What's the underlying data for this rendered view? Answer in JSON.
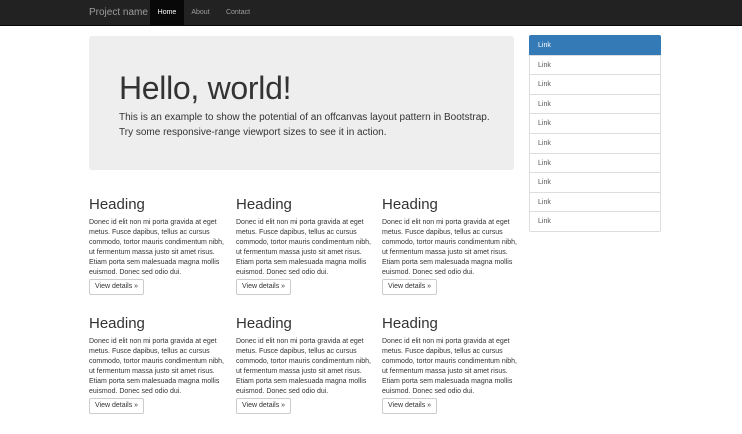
{
  "navbar": {
    "brand": "Project name",
    "items": [
      {
        "label": "Home",
        "active": true
      },
      {
        "label": "About",
        "active": false
      },
      {
        "label": "Contact",
        "active": false
      }
    ]
  },
  "jumbotron": {
    "title": "Hello, world!",
    "text": "This is an example to show the potential of an offcanvas layout pattern in Bootstrap. Try some responsive-range viewport sizes to see it in action."
  },
  "columns": [
    {
      "heading": "Heading",
      "body": "Donec id elit non mi porta gravida at eget metus. Fusce dapibus, tellus ac cursus commodo, tortor mauris condimentum nibh, ut fermentum massa justo sit amet risus. Etiam porta sem malesuada magna mollis euismod. Donec sed odio dui.",
      "button": "View details »"
    },
    {
      "heading": "Heading",
      "body": "Donec id elit non mi porta gravida at eget metus. Fusce dapibus, tellus ac cursus commodo, tortor mauris condimentum nibh, ut fermentum massa justo sit amet risus. Etiam porta sem malesuada magna mollis euismod. Donec sed odio dui.",
      "button": "View details »"
    },
    {
      "heading": "Heading",
      "body": "Donec id elit non mi porta gravida at eget metus. Fusce dapibus, tellus ac cursus commodo, tortor mauris condimentum nibh, ut fermentum massa justo sit amet risus. Etiam porta sem malesuada magna mollis euismod. Donec sed odio dui.",
      "button": "View details »"
    },
    {
      "heading": "Heading",
      "body": "Donec id elit non mi porta gravida at eget metus. Fusce dapibus, tellus ac cursus commodo, tortor mauris condimentum nibh, ut fermentum massa justo sit amet risus. Etiam porta sem malesuada magna mollis euismod. Donec sed odio dui.",
      "button": "View details »"
    },
    {
      "heading": "Heading",
      "body": "Donec id elit non mi porta gravida at eget metus. Fusce dapibus, tellus ac cursus commodo, tortor mauris condimentum nibh, ut fermentum massa justo sit amet risus. Etiam porta sem malesuada magna mollis euismod. Donec sed odio dui.",
      "button": "View details »"
    },
    {
      "heading": "Heading",
      "body": "Donec id elit non mi porta gravida at eget metus. Fusce dapibus, tellus ac cursus commodo, tortor mauris condimentum nibh, ut fermentum massa justo sit amet risus. Etiam porta sem malesuada magna mollis euismod. Donec sed odio dui.",
      "button": "View details »"
    }
  ],
  "sidebar": {
    "items": [
      {
        "label": "Link",
        "active": true
      },
      {
        "label": "Link",
        "active": false
      },
      {
        "label": "Link",
        "active": false
      },
      {
        "label": "Link",
        "active": false
      },
      {
        "label": "Link",
        "active": false
      },
      {
        "label": "Link",
        "active": false
      },
      {
        "label": "Link",
        "active": false
      },
      {
        "label": "Link",
        "active": false
      },
      {
        "label": "Link",
        "active": false
      },
      {
        "label": "Link",
        "active": false
      }
    ]
  },
  "colors": {
    "navbar_bg": "#222222",
    "accent": "#337ab7",
    "jumbotron_bg": "#eeeeee"
  }
}
